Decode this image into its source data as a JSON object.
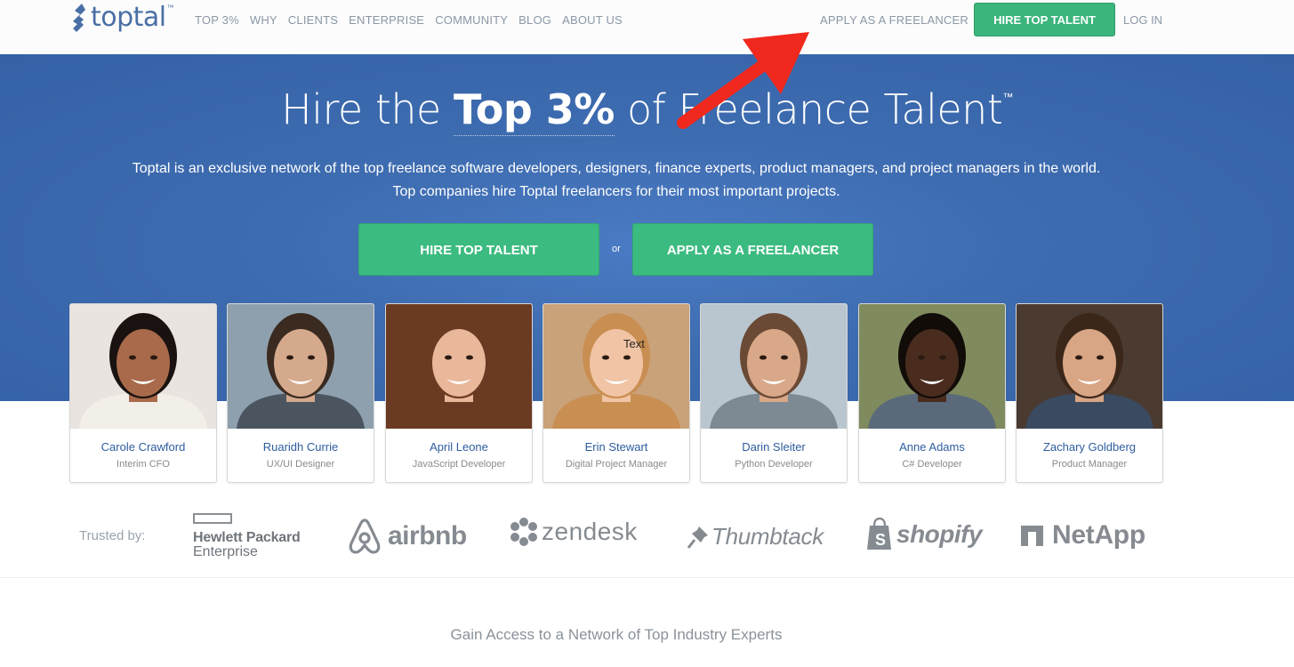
{
  "header": {
    "logo_text": "toptal",
    "logo_tm": "™",
    "nav": [
      "TOP 3%",
      "WHY",
      "CLIENTS",
      "ENTERPRISE",
      "COMMUNITY",
      "BLOG",
      "ABOUT US"
    ],
    "apply_link": "APPLY AS A FREELANCER",
    "hire_button": "HIRE TOP TALENT",
    "login": "LOG IN"
  },
  "hero": {
    "title_pre": "Hire the ",
    "title_strong": "Top 3%",
    "title_post": " of Freelance Talent",
    "title_tm": "™",
    "subtitle_1": "Toptal is an exclusive network of the top freelance software developers, designers, finance experts, product managers, and project managers in the world.",
    "subtitle_2": "Top companies hire Toptal freelancers for their most important projects.",
    "hire_button": "HIRE TOP TALENT",
    "or": "or",
    "apply_button": "APPLY AS A FREELANCER"
  },
  "talent": [
    {
      "name": "Carole Crawford",
      "role": "Interim CFO",
      "skin": "#a86a4a",
      "hair": "#1a1210",
      "bg": "#e9e4df",
      "shirt": "#f2efe9"
    },
    {
      "name": "Ruaridh Currie",
      "role": "UX/UI Designer",
      "skin": "#d5a98c",
      "hair": "#3a2a20",
      "bg": "#8ea0ad",
      "shirt": "#4a5560"
    },
    {
      "name": "April Leone",
      "role": "JavaScript Developer",
      "skin": "#e9b79a",
      "hair": "#6b3a22",
      "bg": "#6b3a22",
      "shirt": "#6b3a22"
    },
    {
      "name": "Erin Stewart",
      "role": "Digital Project Manager",
      "skin": "#f0c4a4",
      "hair": "#c98e52",
      "bg": "#c9a27a",
      "shirt": "#c98e52"
    },
    {
      "name": "Darin Sleiter",
      "role": "Python Developer",
      "skin": "#d9a889",
      "hair": "#6a4a35",
      "bg": "#b9c6cf",
      "shirt": "#7d8a94"
    },
    {
      "name": "Anne Adams",
      "role": "C# Developer",
      "skin": "#4a2c1e",
      "hair": "#120c08",
      "bg": "#7f8a5e",
      "shirt": "#5a6a7a"
    },
    {
      "name": "Zachary Goldberg",
      "role": "Product Manager",
      "skin": "#d8a585",
      "hair": "#3b271a",
      "bg": "#4a3a30",
      "shirt": "#3a4a60"
    }
  ],
  "photo_overlay_text": "Text",
  "trusted_label": "Trusted by:",
  "logos": {
    "hpe_line1": "Hewlett Packard",
    "hpe_line2": "Enterprise",
    "airbnb": "airbnb",
    "zendesk": "zendesk",
    "thumbtack": "Thumbtack",
    "shopify": "shopify",
    "netapp": "NetApp"
  },
  "bottom_title": "Gain Access to a Network of Top Industry Experts",
  "colors": {
    "green": "#3bb57c",
    "blue": "#3e6cb0",
    "link": "#2e5d9f",
    "arrow": "#f0281e"
  }
}
